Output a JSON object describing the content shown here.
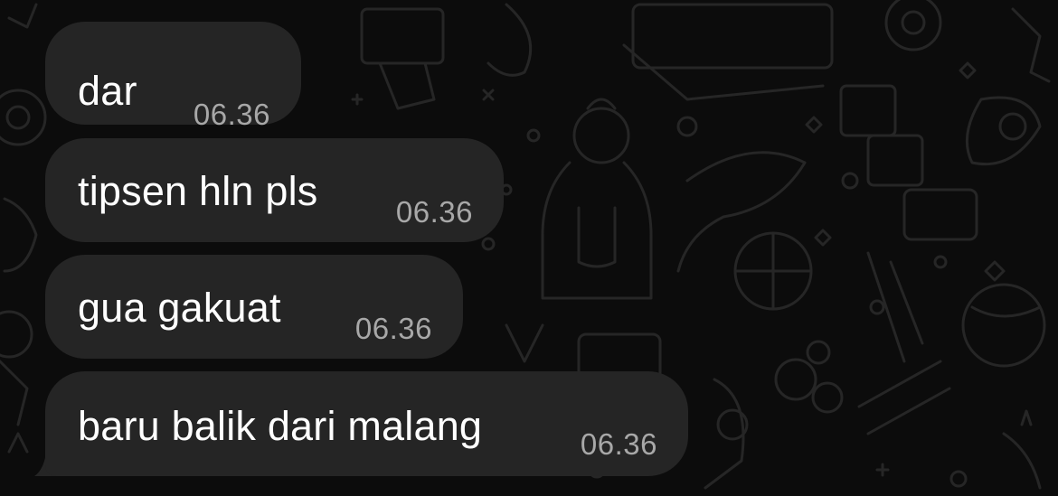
{
  "messages": [
    {
      "text": "dar",
      "time": "06.36"
    },
    {
      "text": "tipsen hln pls",
      "time": "06.36"
    },
    {
      "text": "gua gakuat",
      "time": "06.36"
    },
    {
      "text": "baru balik dari malang",
      "time": "06.36"
    }
  ],
  "colors": {
    "background": "#0c0c0c",
    "bubble": "#252525",
    "text": "#ffffff",
    "timestamp": "#a8a8a8",
    "doodle": "#262626"
  },
  "icons": [
    "chat-doodle-wallpaper"
  ]
}
